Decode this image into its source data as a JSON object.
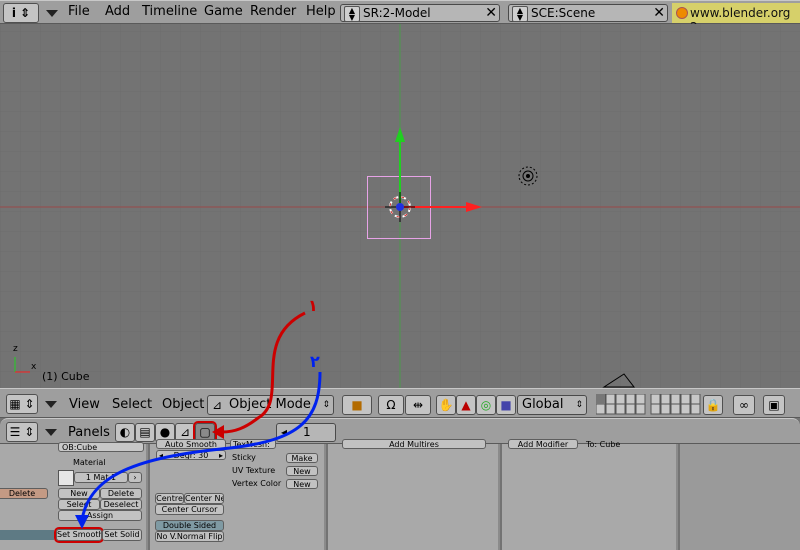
{
  "top_menu": {
    "items": [
      "File",
      "Add",
      "Timeline",
      "Game",
      "Render",
      "Help"
    ],
    "screen_field": "SR:2-Model",
    "scene_field": "SCE:Scene",
    "website": "www.blender.org 2"
  },
  "viewport": {
    "object_label": "(1) Cube",
    "axis_x": "x",
    "axis_z": "z"
  },
  "view_header": {
    "menus": [
      "View",
      "Select",
      "Object"
    ],
    "mode": "Object Mode",
    "orientation": "Global"
  },
  "buttons_header": {
    "panels_label": "Panels",
    "frame": "1"
  },
  "panels": {
    "link": {
      "ob_field": "OB:Cube",
      "material_label": "Material",
      "mat_field": "1 Mat 1",
      "delete_left": "Delete",
      "new": "New",
      "delete": "Delete",
      "select": "Select",
      "deselect": "Deselect",
      "assign": "Assign",
      "set_smooth": "Set Smooth",
      "set_solid": "Set Solid"
    },
    "mesh": {
      "auto_smooth": "Auto Smooth",
      "degr": "Degr: 30",
      "centre": "Centre",
      "center_new": "Center New",
      "center_cursor": "Center Cursor",
      "double_sided": "Double Sided",
      "no_vnormal_flip": "No V.Normal Flip",
      "texmesh": "TexMesh:",
      "sticky": "Sticky",
      "uv_texture": "UV Texture",
      "vertex_color": "Vertex Color",
      "make": "Make",
      "new1": "New",
      "new2": "New"
    },
    "multires": {
      "add_multires": "Add Multires"
    },
    "modifiers": {
      "add_modifier": "Add Modifier",
      "to": "To: Cube"
    }
  },
  "annotations": {
    "label1": "۱",
    "label2": "۲"
  },
  "colors": {
    "viewport_bg": "#737373",
    "header_bg": "#9e9e9e",
    "panel_bg": "#a9a9a9",
    "annotation_red": "#cc0000",
    "annotation_blue": "#0022ee",
    "axis_red": "#ff2020",
    "axis_green": "#20d020",
    "selection_pink": "#e7a3e7"
  }
}
